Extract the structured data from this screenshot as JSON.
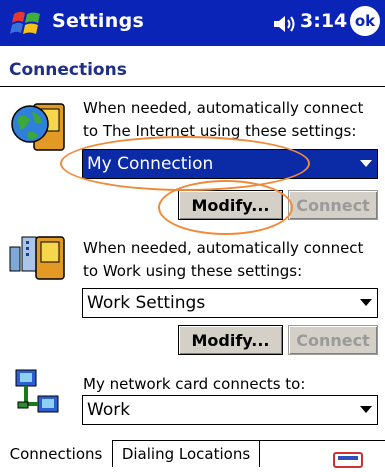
{
  "titlebar": {
    "title": "Settings",
    "time": "3:14",
    "ok_label": "ok",
    "bg_color": "#0a24b8"
  },
  "page": {
    "heading": "Connections"
  },
  "sections": [
    {
      "icon": "internet-connection-icon",
      "description": "When needed, automatically connect to The Internet using these settings:",
      "selected_value": "My Connection",
      "modify_label": "Modify...",
      "connect_label": "Connect"
    },
    {
      "icon": "work-connection-icon",
      "description": "When needed, automatically connect to Work using these settings:",
      "selected_value": "Work Settings",
      "modify_label": "Modify...",
      "connect_label": "Connect"
    },
    {
      "icon": "network-card-icon",
      "description": "My network card connects to:",
      "selected_value": "Work"
    }
  ],
  "tabs": [
    {
      "label": "Connections",
      "active": true
    },
    {
      "label": "Dialing Locations",
      "active": false
    }
  ],
  "colors": {
    "accent": "#0a2aa6",
    "highlight_ring": "#f08a3a",
    "heading": "#1f2f86",
    "button_face": "#d4d0c8"
  }
}
